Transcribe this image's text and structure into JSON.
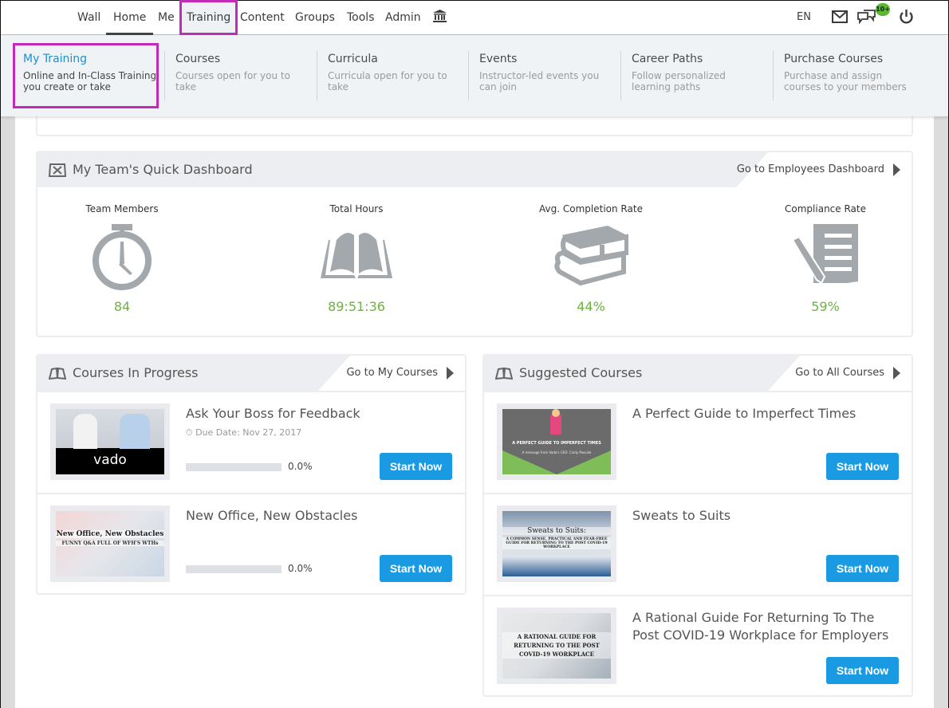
{
  "topnav": {
    "items": [
      "Wall",
      "Home",
      "Me",
      "Training",
      "Content",
      "Groups",
      "Tools",
      "Admin"
    ],
    "language": "EN",
    "notification_badge": "10+"
  },
  "mega_menu": {
    "items": [
      {
        "title": "My Training",
        "desc": "Online and In-Class Training you create or take"
      },
      {
        "title": "Courses",
        "desc": "Courses open for you to take"
      },
      {
        "title": "Curricula",
        "desc": "Curricula open for you to take"
      },
      {
        "title": "Events",
        "desc": "Instructor-led events you can join"
      },
      {
        "title": "Career Paths",
        "desc": "Follow personalized learning paths"
      },
      {
        "title": "Purchase Courses",
        "desc": "Purchase and assign courses to your members"
      }
    ]
  },
  "dashboard": {
    "title": "My Team's Quick Dashboard",
    "link": "Go to Employees Dashboard",
    "stats": [
      {
        "label": "Team Members",
        "value": "84"
      },
      {
        "label": "Total Hours",
        "value": "89:51:36"
      },
      {
        "label": "Avg. Completion Rate",
        "value": "44%"
      },
      {
        "label": "Compliance Rate",
        "value": "59%"
      }
    ]
  },
  "in_progress": {
    "title": "Courses In Progress",
    "link": "Go to My Courses",
    "courses": [
      {
        "title": "Ask Your Boss for Feedback",
        "due": "Due Date: Nov 27, 2017",
        "progress": 0.0,
        "progress_label": "0.0%",
        "button": "Start Now",
        "thumb_text": "vado"
      },
      {
        "title": "New Office, New Obstacles",
        "progress": 0.0,
        "progress_label": "0.0%",
        "button": "Start Now",
        "thumb_text": "New Office, New Obstacles",
        "thumb_sub": "FUNNY Q&A FULL OF WFH'S WTHs"
      }
    ]
  },
  "suggested": {
    "title": "Suggested Courses",
    "link": "Go to All Courses",
    "courses": [
      {
        "title": "A Perfect Guide to Imperfect Times",
        "button": "Start Now",
        "thumb_text": "A PERFECT GUIDE TO IMPERFECT TIMES",
        "thumb_sub": "A message from Vado's CEO: Cindy Pascale"
      },
      {
        "title": "Sweats to Suits",
        "button": "Start Now",
        "thumb_text": "Sweats to Suits:",
        "thumb_sub": "A COMMON SENSE, PRACTICAL AND FEAR-FREE GUIDE FOR RETURNING TO THE POST COVID-19 WORKPLACE"
      },
      {
        "title": "A Rational Guide For Returning To The Post COVID-19 Workplace for Employers",
        "button": "Start Now",
        "thumb_text": "A RATIONAL GUIDE FOR RETURNING TO THE POST COVID-19 WORKPLACE"
      }
    ]
  },
  "colors": {
    "accent": "#1a9ae3",
    "stat_green": "#6cb33f",
    "highlight": "#c22bb7",
    "badge": "#5cb82e"
  }
}
